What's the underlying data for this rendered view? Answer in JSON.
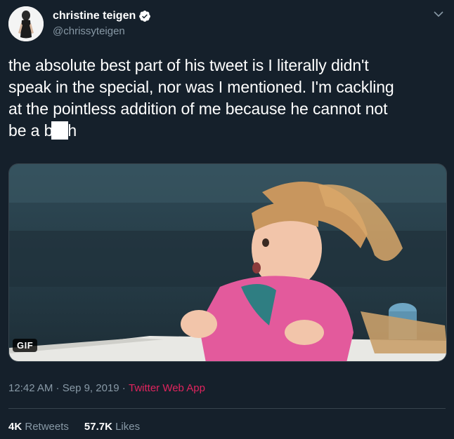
{
  "author": {
    "display_name": "christine teigen",
    "handle": "@chrissyteigen",
    "verified": true
  },
  "tweet": {
    "text_line1": "the absolute best part of his tweet is I literally didn't",
    "text_line2": "speak in the special, nor was I mentioned. I'm cackling",
    "text_line3": "at the pointless addition of me because he cannot not",
    "text_line4_start": "be a b",
    "text_line4_end": "h"
  },
  "media": {
    "badge": "GIF"
  },
  "meta": {
    "time": "12:42 AM",
    "sep1": " · ",
    "date": "Sep 9, 2019",
    "sep2": " · ",
    "source": "Twitter Web App"
  },
  "stats": {
    "retweets_count": "4K",
    "retweets_label": "Retweets",
    "likes_count": "57.7K",
    "likes_label": "Likes"
  },
  "colors": {
    "background": "#15202b",
    "secondary_text": "#8899a6",
    "source_link": "#e0245e",
    "verified_badge": "#ffffff"
  },
  "icons": [
    "verified-badge-icon",
    "chevron-down-icon"
  ]
}
